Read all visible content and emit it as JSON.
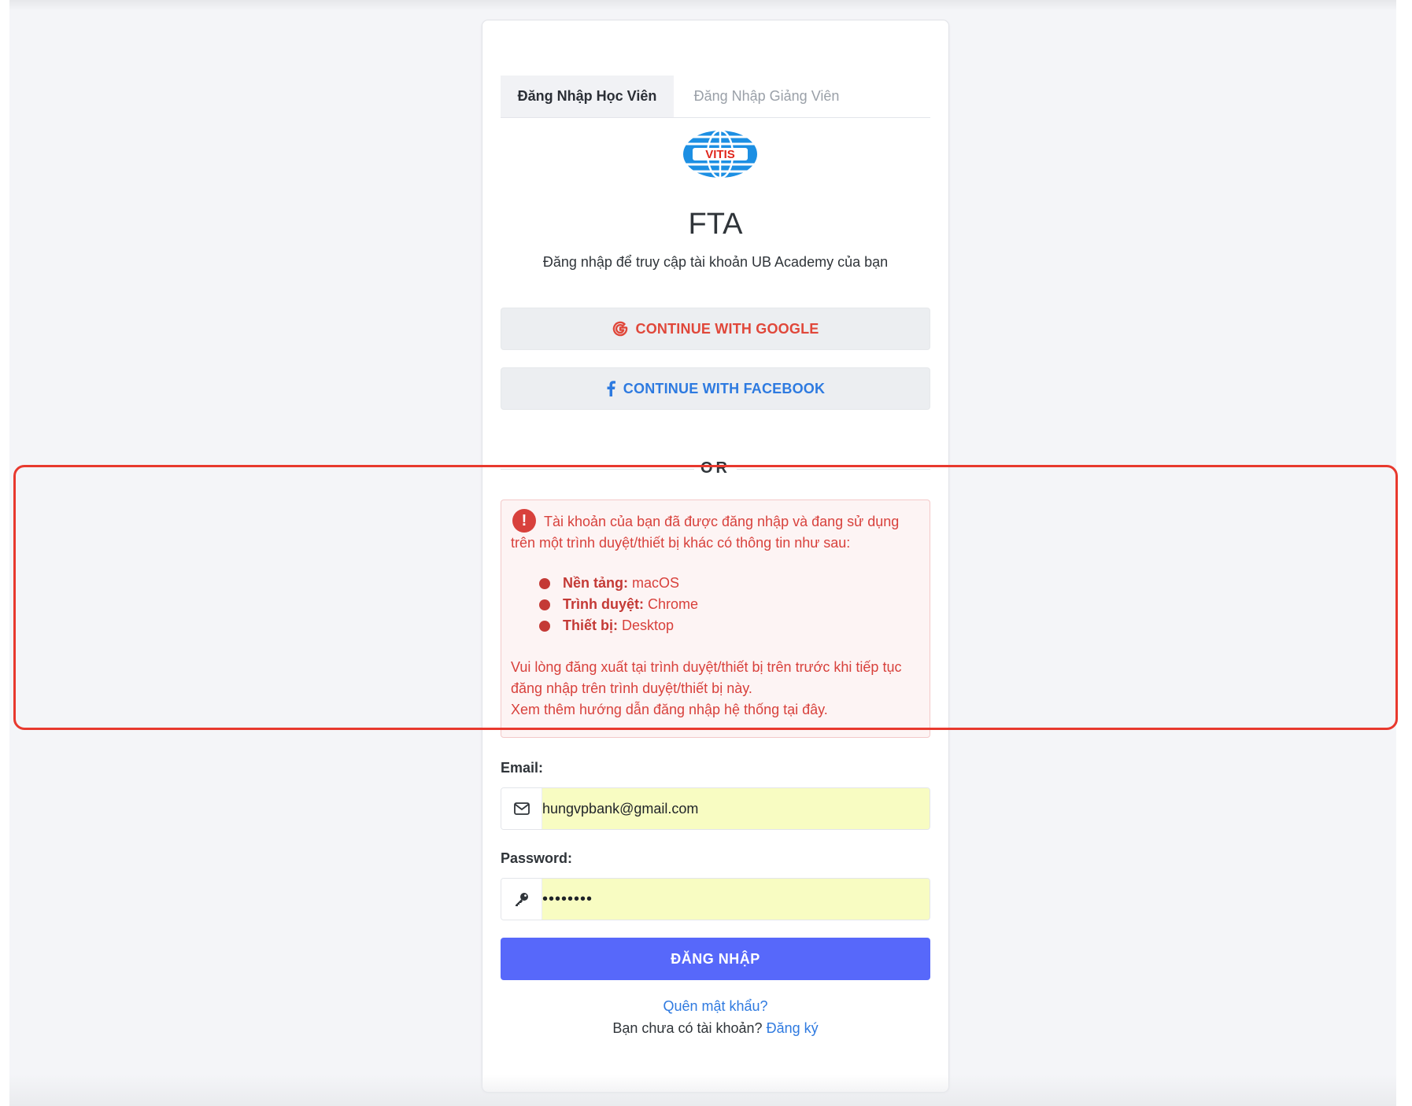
{
  "tabs": {
    "student_login": "Đăng Nhập Học Viên",
    "teacher_login": "Đăng Nhập Giảng Viên"
  },
  "logo": {
    "text": "VITIS"
  },
  "header": {
    "title": "FTA",
    "subtitle": "Đăng nhập để truy cập tài khoản UB Academy của bạn"
  },
  "social": {
    "google_label": "CONTINUE WITH GOOGLE",
    "facebook_label": "CONTINUE WITH FACEBOOK"
  },
  "divider": {
    "or_text": "OR"
  },
  "alert": {
    "icon": "!",
    "intro": "Tài khoản của bạn đã được đăng nhập và đang sử dụng trên một trình duyệt/thiết bị khác có thông tin như sau:",
    "items": [
      {
        "label": "Nền tảng:",
        "value": " macOS"
      },
      {
        "label": "Trình duyệt:",
        "value": " Chrome"
      },
      {
        "label": "Thiết bị:",
        "value": " Desktop"
      }
    ],
    "instruction": "Vui lòng đăng xuất tại trình duyệt/thiết bị trên trước khi tiếp tục đăng nhập trên trình duyệt/thiết bị này.",
    "guide_text": "Xem thêm hướng dẫn đăng nhập hệ thống",
    "guide_link": " tại đây."
  },
  "form": {
    "email_label": "Email:",
    "email_value": "hungvpbank@gmail.com",
    "password_label": "Password:",
    "password_value": "••••••••",
    "submit_label": "ĐĂNG NHẬP"
  },
  "footer": {
    "forgot_password": "Quên mật khẩu?",
    "no_account": "Bạn chưa có tài khoản?",
    "register_link": "Đăng ký"
  },
  "colors": {
    "primary": "#5768fa",
    "google": "#e0473a",
    "facebook": "#2d7ae0",
    "alert": "#d8413c",
    "autofill": "#f8fcc2",
    "highlight": "#e8392e"
  }
}
